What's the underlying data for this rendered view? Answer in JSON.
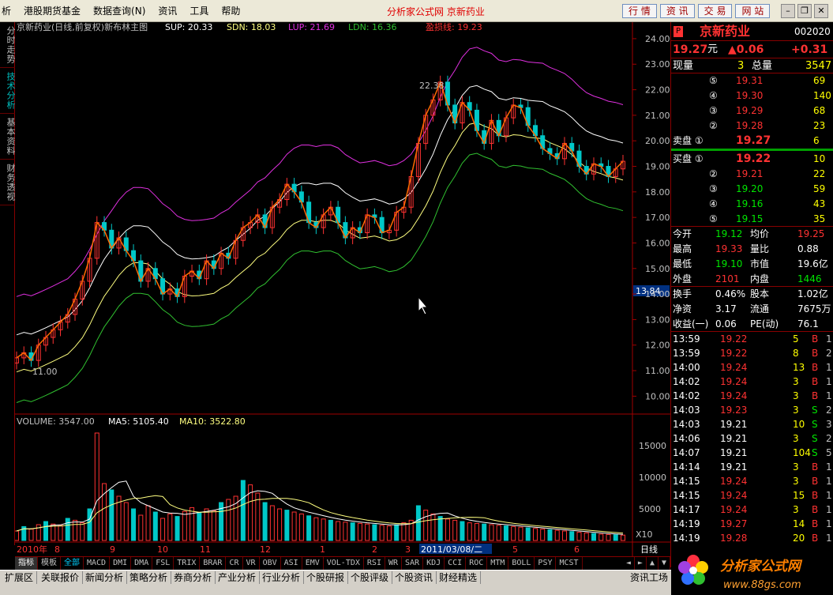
{
  "menu": {
    "items": [
      "析",
      "港股期货基金",
      "数据查询(N)",
      "资讯",
      "工具",
      "帮助"
    ],
    "center": "分析家公式网 京新药业",
    "nav": [
      "行 情",
      "资 讯",
      "交 易",
      "网 站"
    ]
  },
  "vtabs": [
    "分时走势",
    "技术分析",
    "基本资料",
    "财务透视"
  ],
  "chart": {
    "header": "京新药业(日线,前复权)新布林主图",
    "sup": "SUP: 20.33",
    "sdn": "SDN: 18.03",
    "lup": "LUP: 21.69",
    "ldn": "LDN: 16.36",
    "yk": "盈损线: 19.23",
    "high_label": "22.38",
    "low_label": "11.00",
    "price_mark": "13.84",
    "vol_header": "VOLUME: 3547.00",
    "ma5": "MA5: 5105.40",
    "ma10": "MA10: 3522.80",
    "x10": "X10",
    "period": "日线",
    "selected_date": "2011/03/08/二"
  },
  "chart_data": [
    {
      "type": "line",
      "title": "京新药业(日线,前复权)新布林主图",
      "y_ticks": [
        10,
        11,
        12,
        13,
        14,
        15,
        16,
        17,
        18,
        19,
        20,
        21,
        22,
        23,
        24
      ],
      "ylim": [
        9.3,
        24.4
      ],
      "x_ticks": [
        "2010年",
        "8",
        "9",
        "10",
        "11",
        "12",
        "1",
        "2",
        "3",
        "2011/03/08/二",
        "5",
        "6"
      ],
      "series": [
        {
          "name": "SUP",
          "last": 20.33
        },
        {
          "name": "SDN",
          "last": 18.03
        },
        {
          "name": "LUP",
          "last": 21.69
        },
        {
          "name": "LDN",
          "last": 16.36
        },
        {
          "name": "盈损线",
          "last": 19.23
        }
      ],
      "close": [
        11.5,
        11.7,
        11.4,
        12.0,
        12.3,
        12.6,
        12.9,
        13.2,
        13.8,
        14.5,
        15.4,
        16.8,
        16.5,
        15.8,
        16.2,
        15.7,
        15.3,
        14.5,
        15.0,
        14.6,
        14.0,
        14.2,
        13.9,
        14.7,
        14.9,
        14.6,
        15.3,
        15.0,
        15.6,
        15.4,
        16.1,
        16.6,
        16.8,
        17.1,
        16.6,
        17.4,
        17.7,
        18.3,
        18.0,
        17.6,
        16.8,
        16.6,
        17.1,
        17.4,
        16.8,
        16.2,
        16.6,
        16.4,
        17.1,
        17.0,
        16.4,
        16.5,
        17.2,
        17.4,
        18.6,
        19.9,
        21.0,
        21.6,
        22.3,
        21.4,
        20.7,
        21.5,
        21.2,
        20.4,
        19.9,
        20.8,
        20.2,
        20.9,
        21.4,
        21.3,
        20.6,
        20.2,
        19.7,
        19.5,
        19.3,
        19.9,
        19.6,
        19.0,
        18.7,
        19.1,
        19.0,
        18.6,
        18.9,
        19.2
      ]
    },
    {
      "type": "bar",
      "title": "VOLUME",
      "y_ticks": [
        5000,
        10000,
        15000
      ],
      "ylim": [
        0,
        18000
      ],
      "last": 3547.0,
      "ma5": 5105.4,
      "ma10": 3522.8,
      "values": [
        1500,
        2200,
        1800,
        2500,
        3000,
        2600,
        2400,
        3500,
        3200,
        2800,
        5000,
        17000,
        9000,
        8000,
        7000,
        6000,
        5000,
        4000,
        5500,
        4500,
        3500,
        4200,
        3800,
        4600,
        5200,
        4400,
        5000,
        4700,
        6000,
        6500,
        7000,
        9500,
        8800,
        7500,
        6000,
        5500,
        5000,
        4800,
        4500,
        4200,
        3900,
        3600,
        3400,
        3200,
        3000,
        2900,
        2800,
        2700,
        2600,
        2500,
        2400,
        2300,
        2500,
        2800,
        3200,
        5500,
        4800,
        4200,
        3800,
        3400,
        3200,
        3000,
        2800,
        2700,
        2600,
        2500,
        2400,
        2300,
        2200,
        2100,
        2000,
        1900,
        1800,
        1700,
        1600,
        1500,
        1400,
        1300,
        1200,
        1100,
        1000,
        950,
        900,
        850
      ]
    }
  ],
  "quote": {
    "name": "京新药业",
    "code": "002020",
    "price": "19.27",
    "unit": "元",
    "change": "▲0.06",
    "change_pct": "+0.31",
    "xl_label": "现量",
    "xl": "3",
    "zl_label": "总量",
    "zl": "3547",
    "sell": [
      {
        "l": "⑤",
        "p": "19.31",
        "v": "69"
      },
      {
        "l": "④",
        "p": "19.30",
        "v": "140"
      },
      {
        "l": "③",
        "p": "19.29",
        "v": "68"
      },
      {
        "l": "②",
        "p": "19.28",
        "v": "23"
      },
      {
        "l": "卖盘 ①",
        "p": "19.27",
        "v": "6"
      }
    ],
    "buy": [
      {
        "l": "买盘 ①",
        "p": "19.22",
        "v": "10"
      },
      {
        "l": "②",
        "p": "19.21",
        "v": "22"
      },
      {
        "l": "③",
        "p": "19.20",
        "v": "59"
      },
      {
        "l": "④",
        "p": "19.16",
        "v": "43"
      },
      {
        "l": "⑤",
        "p": "19.15",
        "v": "35"
      }
    ],
    "stats": [
      [
        "今开",
        "19.12",
        "均价",
        "19.25"
      ],
      [
        "最高",
        "19.33",
        "量比",
        "0.88"
      ],
      [
        "最低",
        "19.10",
        "市值",
        "19.6亿"
      ],
      [
        "外盘",
        "2101",
        "内盘",
        "1446"
      ],
      [
        "换手",
        "0.46%",
        "股本",
        "1.02亿"
      ],
      [
        "净资",
        "3.17",
        "流通",
        "7675万"
      ],
      [
        "收益(一)",
        "0.06",
        "PE(动)",
        "76.1"
      ]
    ],
    "ticks": [
      [
        "13:59",
        "19.22",
        "5",
        "B",
        "1"
      ],
      [
        "13:59",
        "19.22",
        "8",
        "B",
        "2"
      ],
      [
        "14:00",
        "19.24",
        "13",
        "B",
        "1"
      ],
      [
        "14:02",
        "19.24",
        "3",
        "B",
        "1"
      ],
      [
        "14:02",
        "19.24",
        "3",
        "B",
        "1"
      ],
      [
        "14:03",
        "19.23",
        "3",
        "S",
        "2"
      ],
      [
        "14:03",
        "19.21",
        "10",
        "S",
        "3"
      ],
      [
        "14:06",
        "19.21",
        "3",
        "S",
        "2"
      ],
      [
        "14:07",
        "19.21",
        "104",
        "S",
        "5"
      ],
      [
        "14:14",
        "19.21",
        "3",
        "B",
        "1"
      ],
      [
        "14:15",
        "19.24",
        "3",
        "B",
        "1"
      ],
      [
        "14:15",
        "19.24",
        "15",
        "B",
        "1"
      ],
      [
        "14:17",
        "19.24",
        "3",
        "B",
        "1"
      ],
      [
        "14:19",
        "19.27",
        "14",
        "B",
        "1"
      ],
      [
        "14:19",
        "19.28",
        "20",
        "B",
        "1"
      ]
    ]
  },
  "indicators": [
    "指标",
    "模板",
    "全部",
    "MACD",
    "DMI",
    "DMA",
    "FSL",
    "TRIX",
    "BRAR",
    "CR",
    "VR",
    "OBV",
    "ASI",
    "EMV",
    "VOL-TDX",
    "RSI",
    "WR",
    "SAR",
    "KDJ",
    "CCI",
    "ROC",
    "MTM",
    "BOLL",
    "PSY",
    "MCST"
  ],
  "status": [
    "扩展区",
    "关联报价",
    "新闻分析",
    "策略分析",
    "券商分析",
    "产业分析",
    "行业分析",
    "个股研报",
    "个股评级",
    "个股资讯",
    "财经精选",
    "资讯工场"
  ],
  "logo": {
    "text": "分析家公式网",
    "url": "www.88gs.com"
  },
  "colors": {
    "up": "#ff3232",
    "down": "#00e600",
    "sup": "#ffffff",
    "sdn": "#ffff80",
    "lup": "#e030e0",
    "ldn": "#30c030",
    "line": "#ff6a00"
  }
}
